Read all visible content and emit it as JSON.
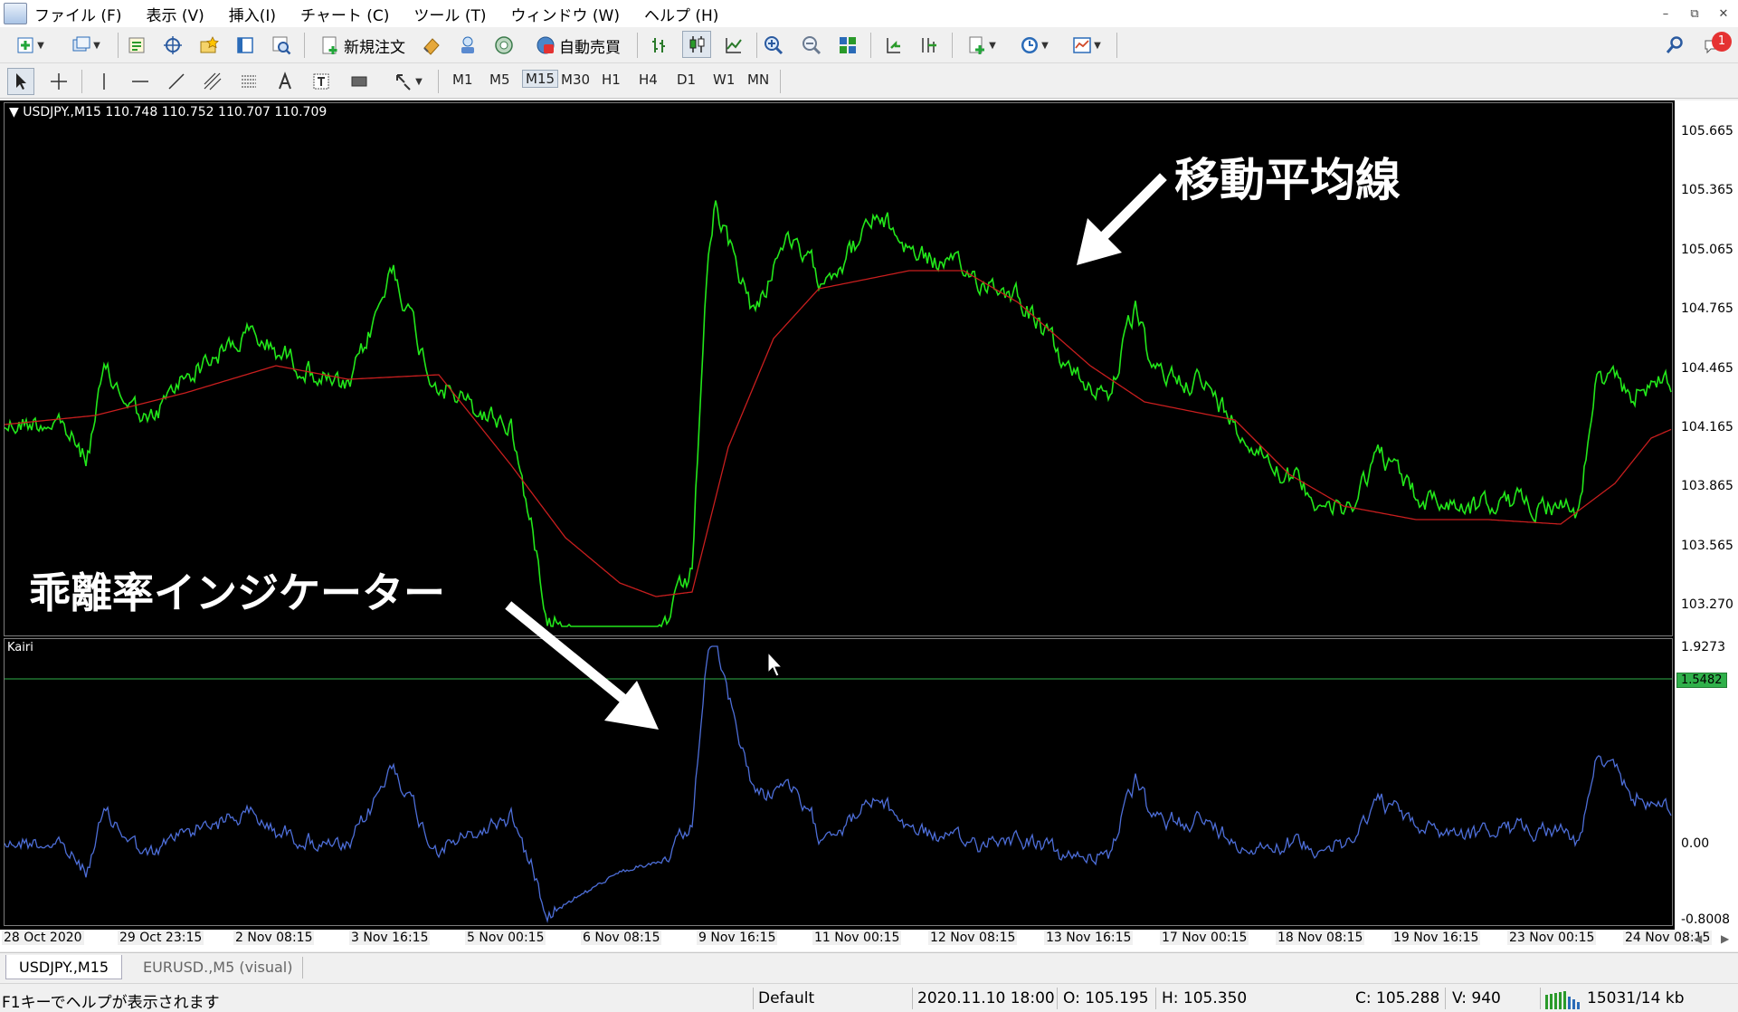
{
  "menu": [
    "ファイル (F)",
    "表示 (V)",
    "挿入(I)",
    "チャート (C)",
    "ツール (T)",
    "ウィンドウ (W)",
    "ヘルプ (H)"
  ],
  "toolbar": {
    "new_order": "新規注文",
    "auto_trading": "自動売買",
    "notification_count": "1"
  },
  "timeframes": [
    "M1",
    "M5",
    "M15",
    "M30",
    "H1",
    "H4",
    "D1",
    "W1",
    "MN"
  ],
  "active_timeframe": "M15",
  "chart": {
    "header": "USDJPY.,M15  110.748 110.752 110.707 110.709",
    "price_axis": [
      "105.665",
      "105.365",
      "105.065",
      "104.765",
      "104.465",
      "104.165",
      "103.865",
      "103.565",
      "103.270"
    ],
    "indicator_name": "Kairi",
    "indicator_axis": [
      "1.9273",
      "0.00",
      "-0.8008"
    ],
    "level_value": "1.5482",
    "time_axis": [
      "28 Oct 2020",
      "29 Oct 23:15",
      "2 Nov 08:15",
      "3 Nov 16:15",
      "5 Nov 00:15",
      "6 Nov 08:15",
      "9 Nov 16:15",
      "11 Nov 00:15",
      "12 Nov 08:15",
      "13 Nov 16:15",
      "17 Nov 00:15",
      "18 Nov 08:15",
      "19 Nov 16:15",
      "23 Nov 00:15",
      "24 Nov 08:15"
    ],
    "colors": {
      "price": "#22e61a",
      "ma": "#c81e1e",
      "indicator": "#4d6ed8",
      "level": "#2fb04a"
    }
  },
  "annotations": {
    "ma_label": "移動平均線",
    "indicator_label": "乖離率インジケーター"
  },
  "tabs": [
    "USDJPY.,M15",
    "EURUSD.,M5 (visual)"
  ],
  "status": {
    "help": "F1キーでヘルプが表示されます",
    "profile": "Default",
    "datetime": "2020.11.10 18:00",
    "open": "O: 105.195",
    "high": "H: 105.350",
    "close": "C: 105.288",
    "volume": "V: 940",
    "traffic": "15031/14 kb"
  }
}
